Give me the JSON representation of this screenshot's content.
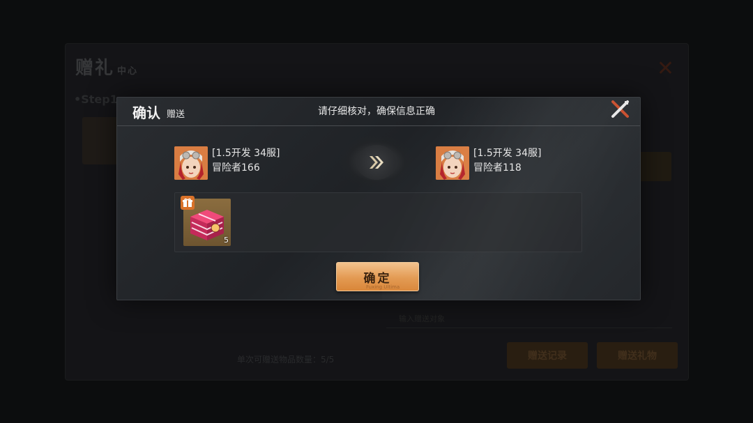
{
  "background": {
    "title": "赠礼",
    "title_small": "中心",
    "step_label": "•Step1",
    "count_text": "单次可赠送物品数量：5/5",
    "input_placeholder": "输入赠送对象",
    "button_records": "赠送记录",
    "button_send": "赠送礼物"
  },
  "dialog": {
    "title": "确认",
    "subtitle": "赠送",
    "notice": "请仔细核对，确保信息正确",
    "from": {
      "server": "[1.5开发 34服]",
      "name": "冒险者166"
    },
    "to": {
      "server": "[1.5开发 34服]",
      "name": "冒险者118"
    },
    "items": [
      {
        "icon": "gift-box-icon",
        "quantity": "5"
      }
    ],
    "confirm_label": "确定",
    "confirm_watermark": "Fuxing Ultima"
  },
  "colors": {
    "accent": "#e39a52",
    "close_icon": "#c9502f"
  }
}
